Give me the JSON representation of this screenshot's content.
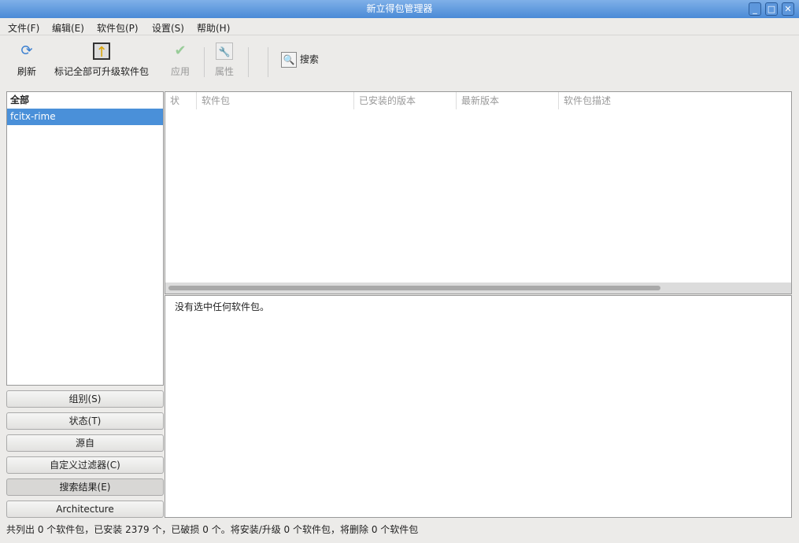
{
  "window": {
    "title": "新立得包管理器"
  },
  "menu": [
    "文件(F)",
    "编辑(E)",
    "软件包(P)",
    "设置(S)",
    "帮助(H)"
  ],
  "toolbar": {
    "refresh": "刷新",
    "mark_all": "标记全部可升级软件包",
    "apply": "应用",
    "properties": "属性",
    "search": "搜索"
  },
  "filter_list": [
    "全部",
    "fcitx-rime"
  ],
  "filter_buttons": [
    "组别(S)",
    "状态(T)",
    "源自",
    "自定义过滤器(C)",
    "搜索结果(E)",
    "Architecture"
  ],
  "table": {
    "columns": [
      "状",
      "软件包",
      "已安装的版本",
      "最新版本",
      "软件包描述"
    ]
  },
  "detail": "没有选中任何软件包。",
  "status": "共列出 0 个软件包，已安装 2379 个，已破损 0 个。将安装/升级 0 个软件包，将删除 0 个软件包"
}
